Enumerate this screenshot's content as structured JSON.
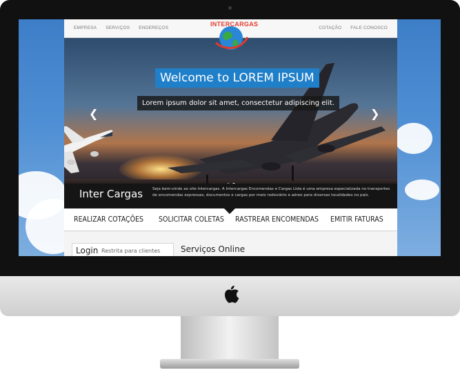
{
  "colors": {
    "accent": "#1f7fc9",
    "logo_red": "#e33a2c",
    "dark_band": "#151515",
    "sky": "#4f8fd4"
  },
  "icons": {
    "logo": "intercargas-globe-logo",
    "device": "apple-icon",
    "prev": "chevron-left-icon",
    "next": "chevron-right-icon"
  },
  "nav": {
    "left": [
      "EMPRESA",
      "SERVIÇOS",
      "ENDEREÇOS"
    ],
    "right": [
      "COTAÇÃO",
      "FALE CONOSCO"
    ]
  },
  "logo": {
    "text": "INTERCARGAS"
  },
  "hero": {
    "title": "Welcome to LOREM IPSUM",
    "subtitle": "Lorem ipsum dolor sit amet, consectetur adipiscing elit.",
    "prev_arrow": "❮",
    "next_arrow": "❯",
    "slide_count": 2,
    "active_slide": 2
  },
  "intro": {
    "brand": "Inter Cargas",
    "text": "Seja bem-vindo ao site Intercargas. A Intercargas Encomendas e Cargas Ltda é uma empresa especializada no transportes de encomendas expressas, documentos e cargas por meio rodoviário e aéreo para diversas localidades no país."
  },
  "services": [
    "REALIZAR COTAÇÕES",
    "SOLICITAR COLETAS",
    "RASTREAR ENCOMENDAS",
    "EMITIR FATURAS"
  ],
  "login": {
    "title": "Login",
    "subtitle": "Restrita para clientes"
  },
  "online": {
    "title": "Serviços Online"
  }
}
